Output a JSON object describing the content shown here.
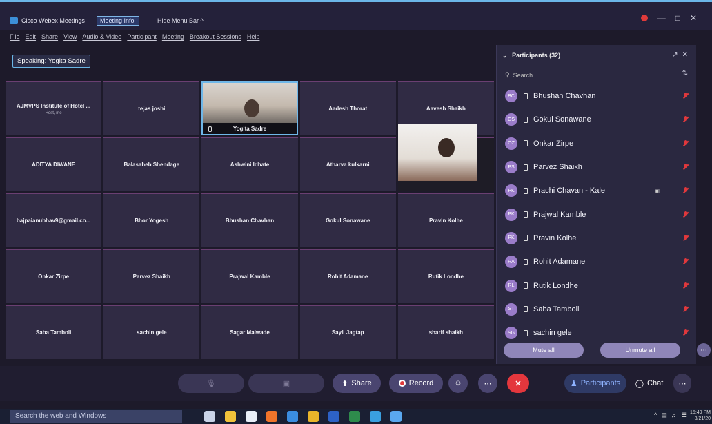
{
  "titlebar": {
    "app_title": "Cisco Webex Meetings",
    "meeting_info": "Meeting Info",
    "hide_menu_bar": "Hide Menu Bar ^"
  },
  "menu": [
    "File",
    "Edit",
    "Share",
    "View",
    "Audio & Video",
    "Participant",
    "Meeting",
    "Breakout Sessions",
    "Help"
  ],
  "speaking": "Speaking: Yogita Sadre",
  "grid": [
    {
      "name": "AJMVPS Institute of Hotel ...",
      "sub": "Host, me"
    },
    {
      "name": "tejas joshi"
    },
    {
      "name": "Yogita Sadre",
      "video": true
    },
    {
      "name": "Aadesh Thorat"
    },
    {
      "name": "Aavesh Shaikh"
    },
    {
      "name": "ADITYA DIWANE"
    },
    {
      "name": "Balasaheb Shendage"
    },
    {
      "name": "Ashwini Idhate"
    },
    {
      "name": "Atharva kulkarni"
    },
    {
      "name": "",
      "video2": true
    },
    {
      "name": "bajpaianubhav9@gmail.co..."
    },
    {
      "name": "Bhor Yogesh"
    },
    {
      "name": "Bhushan Chavhan"
    },
    {
      "name": "Gokul Sonawane"
    },
    {
      "name": "Pravin Kolhe"
    },
    {
      "name": "Onkar Zirpe"
    },
    {
      "name": "Parvez Shaikh"
    },
    {
      "name": "Prajwal Kamble"
    },
    {
      "name": "Rohit Adamane"
    },
    {
      "name": "Rutik Londhe"
    },
    {
      "name": "Saba Tamboli"
    },
    {
      "name": "sachin gele"
    },
    {
      "name": "Sagar Malwade"
    },
    {
      "name": "Sayli Jagtap"
    },
    {
      "name": "sharif shaikh"
    }
  ],
  "panel": {
    "title": "Participants (32)",
    "search_placeholder": "Search",
    "participants": [
      {
        "initials": "BC",
        "name": "Bhushan Chavhan"
      },
      {
        "initials": "GS",
        "name": "Gokul Sonawane"
      },
      {
        "initials": "OZ",
        "name": "Onkar Zirpe"
      },
      {
        "initials": "PS",
        "name": "Parvez Shaikh"
      },
      {
        "initials": "PK",
        "name": "Prachi Chavan - Kale",
        "cam": true
      },
      {
        "initials": "PK",
        "name": "Prajwal Kamble"
      },
      {
        "initials": "PK",
        "name": "Pravin Kolhe"
      },
      {
        "initials": "RA",
        "name": "Rohit Adamane"
      },
      {
        "initials": "RL",
        "name": "Rutik Londhe"
      },
      {
        "initials": "ST",
        "name": "Saba Tamboli"
      },
      {
        "initials": "SG",
        "name": "sachin gele"
      }
    ],
    "mute_all": "Mute all",
    "unmute_all": "Unmute all"
  },
  "toolbar": {
    "share": "Share",
    "record": "Record",
    "participants": "Participants",
    "chat": "Chat"
  },
  "taskbar": {
    "search": "Search the web and Windows",
    "time": "15:49 PM",
    "date": "8/21/20"
  },
  "colors": {
    "accent": "#6fb7e8",
    "leave": "#e4373d",
    "mute": "#e0383c",
    "panel_bg": "#2a2840"
  }
}
